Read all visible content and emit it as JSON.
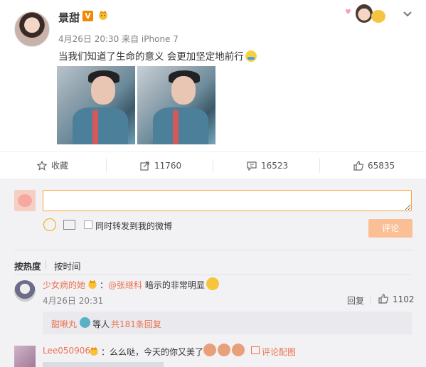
{
  "post": {
    "author": "景甜",
    "verified_badge": "V",
    "meta": "4月26日 20:30 来自 iPhone 7",
    "text": "当我们知道了生命的意义 会更加坚定地前行",
    "images": [
      "photo-1",
      "photo-2"
    ],
    "icons": {
      "collapse": "chevron-down-icon",
      "top_right": "avatar-sticker-icon"
    }
  },
  "actions": {
    "favorite": "收藏",
    "repost": "11760",
    "comment": "16523",
    "like": "65835"
  },
  "comment_box": {
    "placeholder": "",
    "repost_check_label": "同时转发到我的微博",
    "submit": "评论"
  },
  "sort": {
    "hot": "按热度",
    "time": "按时间"
  },
  "comments": [
    {
      "user": "少女病的她",
      "mention": "@张继科",
      "text": " 暗示的非常明显",
      "time": "4月26日 20:31",
      "reply_label": "回复",
      "likes": "1102",
      "sub_user": "甜啾丸",
      "sub_text": "等人",
      "sub_count": "共181条回复"
    },
    {
      "user": "Lee050906",
      "text": "：么么哒，今天的你又美了",
      "link": "评论配图"
    }
  ],
  "colors": {
    "accent": "#eb7350",
    "submit_disabled": "#fbbf95",
    "input_border": "#ffa033",
    "panel_bg": "#f2f2f5"
  }
}
